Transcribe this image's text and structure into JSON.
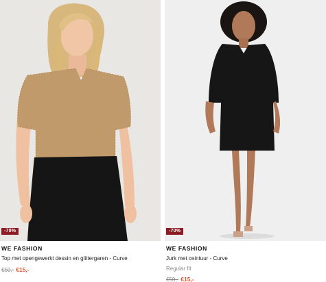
{
  "products": [
    {
      "badge": "-70%",
      "brand": "WE FASHION",
      "title": "Top met opengewerkt dessin en glittergaren - Curve",
      "price_old": "€50,-",
      "price_new": "€15,-"
    },
    {
      "badge": "-70%",
      "brand": "WE FASHION",
      "title": "Jurk met ceintuur - Curve",
      "fit": "Regular fit",
      "price_old": "€50,-",
      "price_new": "€15,-"
    }
  ],
  "colors": {
    "badge_bg": "#8c1d24",
    "sale_price": "#e4572e",
    "muted_text": "#8a8a8a"
  }
}
